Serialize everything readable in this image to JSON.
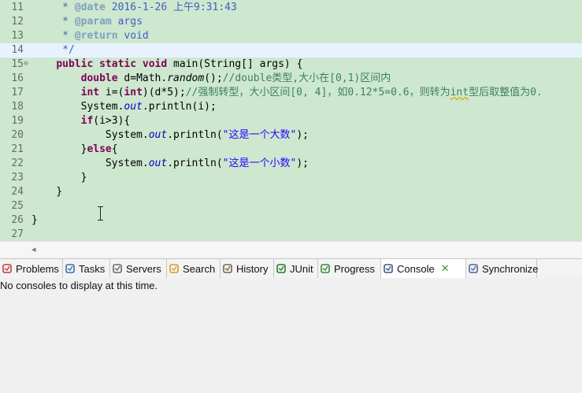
{
  "editor": {
    "lines": [
      {
        "num": "11",
        "segs": [
          {
            "c": "jdoc",
            "t": "     * "
          },
          {
            "c": "jtag",
            "t": "@date"
          },
          {
            "c": "jdoc",
            "t": " 2016-1-26 上午9:31:43"
          }
        ]
      },
      {
        "num": "12",
        "segs": [
          {
            "c": "jdoc",
            "t": "     * "
          },
          {
            "c": "jtag",
            "t": "@param"
          },
          {
            "c": "jdoc",
            "t": " args"
          }
        ]
      },
      {
        "num": "13",
        "segs": [
          {
            "c": "jdoc",
            "t": "     * "
          },
          {
            "c": "jtag",
            "t": "@return"
          },
          {
            "c": "jdoc",
            "t": " void"
          }
        ]
      },
      {
        "num": "14",
        "segs": [
          {
            "c": "jdoc",
            "t": "     */"
          }
        ]
      },
      {
        "num": "15",
        "fold": "⊖",
        "segs": [
          {
            "c": "",
            "t": "    "
          },
          {
            "c": "kw",
            "t": "public"
          },
          {
            "c": "",
            "t": " "
          },
          {
            "c": "kw",
            "t": "static"
          },
          {
            "c": "",
            "t": " "
          },
          {
            "c": "kw",
            "t": "void"
          },
          {
            "c": "",
            "t": " main(String[] args) {"
          }
        ]
      },
      {
        "num": "16",
        "segs": [
          {
            "c": "",
            "t": "        "
          },
          {
            "c": "kw",
            "t": "double"
          },
          {
            "c": "",
            "t": " d=Math."
          },
          {
            "c": "ital",
            "t": "random"
          },
          {
            "c": "",
            "t": "();"
          },
          {
            "c": "cmt",
            "t": "//double类型,大小在[0,1)区间内"
          }
        ]
      },
      {
        "num": "17",
        "segs": [
          {
            "c": "",
            "t": "        "
          },
          {
            "c": "kw",
            "t": "int"
          },
          {
            "c": "",
            "t": " i=("
          },
          {
            "c": "kw",
            "t": "int"
          },
          {
            "c": "",
            "t": ")(d*5);"
          },
          {
            "c": "cmt",
            "t": "//强制转型，大小区间[0, 4]，如0.12*5=0.6，则转为"
          },
          {
            "c": "cmt squig",
            "t": "int"
          },
          {
            "c": "cmt",
            "t": "型后取整值为0."
          }
        ]
      },
      {
        "num": "18",
        "segs": [
          {
            "c": "",
            "t": "        System."
          },
          {
            "c": "fld",
            "t": "out"
          },
          {
            "c": "",
            "t": ".println(i);"
          }
        ]
      },
      {
        "num": "19",
        "segs": [
          {
            "c": "",
            "t": "        "
          },
          {
            "c": "kw",
            "t": "if"
          },
          {
            "c": "",
            "t": "(i>3){"
          }
        ]
      },
      {
        "num": "20",
        "segs": [
          {
            "c": "",
            "t": "            System."
          },
          {
            "c": "fld",
            "t": "out"
          },
          {
            "c": "",
            "t": ".println("
          },
          {
            "c": "str",
            "t": "\"这是一个大数\""
          },
          {
            "c": "",
            "t": ");"
          }
        ]
      },
      {
        "num": "21",
        "segs": [
          {
            "c": "",
            "t": "        }"
          },
          {
            "c": "kw",
            "t": "else"
          },
          {
            "c": "",
            "t": "{"
          }
        ]
      },
      {
        "num": "22",
        "segs": [
          {
            "c": "",
            "t": "            System."
          },
          {
            "c": "fld",
            "t": "out"
          },
          {
            "c": "",
            "t": ".println("
          },
          {
            "c": "str",
            "t": "\"这是一个小数\""
          },
          {
            "c": "",
            "t": ");"
          }
        ]
      },
      {
        "num": "23",
        "segs": [
          {
            "c": "",
            "t": "        }"
          }
        ]
      },
      {
        "num": "24",
        "segs": [
          {
            "c": "",
            "t": "    }"
          }
        ]
      },
      {
        "num": "25",
        "segs": [
          {
            "c": "",
            "t": ""
          }
        ]
      },
      {
        "num": "26",
        "segs": [
          {
            "c": "",
            "t": "}"
          }
        ]
      },
      {
        "num": "27",
        "segs": [
          {
            "c": "",
            "t": ""
          }
        ]
      }
    ]
  },
  "tabs": [
    {
      "label": "Problems",
      "icon": "problems-icon"
    },
    {
      "label": "Tasks",
      "icon": "tasks-icon"
    },
    {
      "label": "Servers",
      "icon": "servers-icon"
    },
    {
      "label": "Search",
      "icon": "search-icon"
    },
    {
      "label": "History",
      "icon": "history-icon"
    },
    {
      "label": "JUnit",
      "icon": "junit-icon"
    },
    {
      "label": "Progress",
      "icon": "progress-icon"
    },
    {
      "label": "Console",
      "icon": "console-icon",
      "active": true,
      "close": "✕"
    },
    {
      "label": "Synchronize",
      "icon": "synchronize-icon"
    }
  ],
  "console": {
    "message": "No consoles to display at this time."
  },
  "colors": {
    "editor_bg": "#cde8cf",
    "keyword": "#7f0055",
    "javadoc": "#3f5fbf",
    "comment": "#3f7f5f",
    "string": "#2a00ff"
  }
}
